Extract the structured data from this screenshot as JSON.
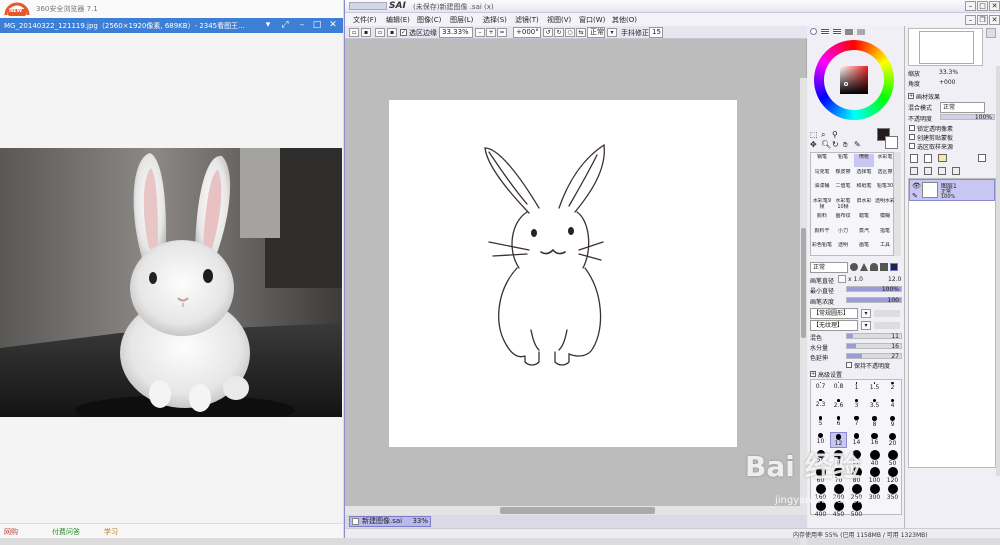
{
  "browser": {
    "logo_text": "NEW",
    "app_title": "360安全浏览器 7.1",
    "tab_title": "MG_20140322_121119.jpg（2560×1920像素, 689KB）- 2345看图王...",
    "bottom_items": [
      "网购",
      "付费问答",
      "学习"
    ]
  },
  "sai": {
    "logo": "SAI",
    "doc_title": "(未保存)新建图像",
    "doc_ext": ".sai (x)",
    "menu": [
      "文件(F)",
      "编辑(E)",
      "图像(C)",
      "图层(L)",
      "选择(S)",
      "滤镜(T)",
      "视图(V)",
      "窗口(W)",
      "其他(O)"
    ],
    "toolbar": {
      "selection_edge": "选区边缘",
      "zoom": "33.33%",
      "rotation": "+000°",
      "blend": "正常",
      "stabilizer_label": "手抖修正",
      "stabilizer_value": "15"
    },
    "nav_tab": {
      "label": "新建图像.sai",
      "zoom": "33%"
    },
    "status": "内存使用率 55% (已用 1158MB / 可用 1323MB)",
    "watermark": "Bai 经验",
    "watermark_url": "jingyan.baidu.com",
    "color_panel": {
      "fg_color": "#241a1c",
      "bg_color": "#ffffff"
    },
    "tools": [
      [
        "钢笔",
        "铅笔",
        "喷枪",
        "水彩笔"
      ],
      [
        "马克笔",
        "橡皮擦",
        "选择笔",
        "选区擦"
      ],
      [
        "油漆桶",
        "二值笔",
        "和纸笔",
        "铅笔30"
      ],
      [
        "水彩笔9帧",
        "水彩笔10帧",
        "旧水彩",
        "透明水彩"
      ],
      [
        "颜料",
        "画布纹",
        "蜡笔",
        "模糊"
      ],
      [
        "颜料干",
        "小刀",
        "蒸汽",
        "指笔"
      ],
      [
        "彩色铅笔",
        "透明",
        "画笔",
        "工具"
      ]
    ],
    "brush_settings": {
      "mode": "正常",
      "size_label": "画笔直径",
      "size_mult": "x 1.0",
      "size_value": "12.0",
      "min_size_label": "最小直径",
      "min_size_value": "100%",
      "density_label": "画笔浓度",
      "density_value": "100",
      "shape_label": "【常规圆形】",
      "texture_label": "【无纹理】",
      "blend_label": "混色",
      "blend_value": "11",
      "water_label": "水分量",
      "water_value": "16",
      "persistence_label": "色延伸",
      "persistence_value": "27",
      "keep_opacity": "保持不透明度",
      "advanced": "高级设置"
    },
    "brush_sizes": [
      "0.7",
      "0.8",
      "1",
      "1.5",
      "2",
      "2.3",
      "2.6",
      "3",
      "3.5",
      "4",
      "5",
      "6",
      "7",
      "8",
      "9",
      "10",
      "12",
      "14",
      "16",
      "20",
      "25",
      "30",
      "35",
      "40",
      "50",
      "60",
      "70",
      "80",
      "100",
      "120",
      "160",
      "200",
      "250",
      "300",
      "350",
      "400",
      "450",
      "500"
    ],
    "navigator": {
      "zoom_label": "缩放",
      "zoom_value": "33.3%",
      "angle_label": "角度",
      "angle_value": "+000"
    },
    "layer_panel": {
      "effect_title": "画材效果",
      "blend_label": "混合模式",
      "blend_value": "正常",
      "opacity_label": "不透明度",
      "opacity_value": "100%",
      "check_lock": "锁定透明像素",
      "check_clip": "创建剪贴蒙板",
      "check_sel": "选区取样来源",
      "layer_name": "图层1",
      "layer_mode": "正常",
      "layer_opacity": "100%"
    }
  }
}
